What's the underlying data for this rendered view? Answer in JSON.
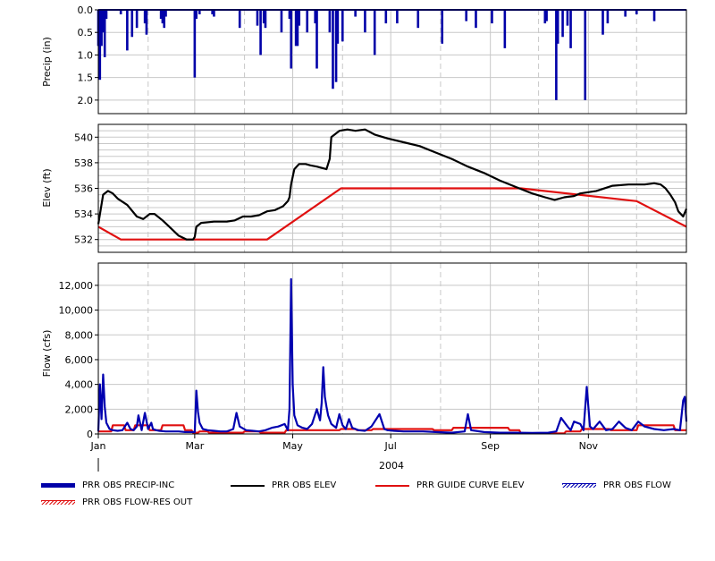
{
  "chart_data": [
    {
      "type": "bar",
      "ylabel": "Precip (in)",
      "ylim": [
        2.3,
        0
      ],
      "yticks": [
        "0.0",
        "0.5",
        "1.0",
        "1.5",
        "2.0"
      ],
      "ytick_values": [
        0,
        0.5,
        1.0,
        1.5,
        2.0
      ],
      "x_domain_days": 366,
      "series": [
        {
          "name": "PRR OBS PRECIP-INC",
          "color": "#0000a8",
          "x_day": [
            0,
            1,
            2,
            3,
            4,
            5,
            14,
            18,
            21,
            24,
            29,
            30,
            39,
            40,
            41,
            42,
            60,
            61,
            63,
            71,
            72,
            88,
            99,
            101,
            103,
            104,
            114,
            119,
            120,
            123,
            124,
            125,
            130,
            135,
            136,
            144,
            146,
            148,
            149,
            152,
            160,
            166,
            172,
            179,
            186,
            199,
            214,
            229,
            235,
            245,
            253,
            278,
            279,
            285,
            286,
            289,
            292,
            294,
            303,
            314,
            317,
            328,
            335,
            346
          ],
          "values": [
            0.8,
            1.55,
            0.8,
            0.5,
            1.05,
            0.2,
            0.1,
            0.9,
            0.6,
            0.4,
            0.3,
            0.55,
            0.2,
            0.3,
            0.4,
            0.15,
            1.5,
            0.2,
            0.1,
            0.1,
            0.15,
            0.4,
            0.35,
            1.0,
            0.3,
            0.4,
            0.5,
            0.2,
            1.3,
            0.8,
            0.8,
            0.35,
            0.5,
            0.3,
            1.3,
            0.5,
            1.75,
            1.6,
            0.75,
            0.7,
            0.15,
            0.5,
            1.0,
            0.3,
            0.3,
            0.4,
            0.75,
            0.25,
            0.4,
            0.3,
            0.85,
            0.3,
            0.25,
            2.0,
            0.75,
            0.6,
            0.35,
            0.85,
            2.0,
            0.55,
            0.3,
            0.15,
            0.1,
            0.25
          ]
        }
      ]
    },
    {
      "type": "line",
      "ylabel": "Elev (ft)",
      "ylim": [
        531,
        541
      ],
      "yticks": [
        "532",
        "534",
        "536",
        "538",
        "540"
      ],
      "ytick_values": [
        532,
        534,
        536,
        538,
        540
      ],
      "x_domain_days": 366,
      "series": [
        {
          "name": "PRR OBS ELEV",
          "color": "#000000",
          "x_day": [
            0,
            3,
            6,
            9,
            12,
            18,
            24,
            28,
            32,
            35,
            40,
            45,
            50,
            55,
            59,
            60,
            61,
            64,
            72,
            80,
            85,
            90,
            95,
            100,
            105,
            110,
            115,
            118,
            119,
            120,
            122,
            125,
            129,
            132,
            136,
            142,
            144,
            145,
            150,
            155,
            160,
            166,
            172,
            180,
            190,
            200,
            210,
            220,
            230,
            240,
            250,
            262,
            270,
            278,
            284,
            290,
            296,
            300,
            310,
            320,
            330,
            340,
            346,
            350,
            353,
            356,
            359,
            361,
            364,
            366
          ],
          "values": [
            533.2,
            535.5,
            535.8,
            535.6,
            535.2,
            534.7,
            533.8,
            533.6,
            534.0,
            534.0,
            533.5,
            532.9,
            532.3,
            532.0,
            532.0,
            532.2,
            533.0,
            533.3,
            533.4,
            533.4,
            533.5,
            533.8,
            533.8,
            533.9,
            534.2,
            534.3,
            534.6,
            535.0,
            535.3,
            536.3,
            537.5,
            537.9,
            537.9,
            537.8,
            537.7,
            537.5,
            538.3,
            540.0,
            540.5,
            540.6,
            540.5,
            540.6,
            540.2,
            539.9,
            539.6,
            539.3,
            538.8,
            538.3,
            537.7,
            537.2,
            536.6,
            536.0,
            535.6,
            535.3,
            535.1,
            535.3,
            535.4,
            535.6,
            535.8,
            536.2,
            536.3,
            536.3,
            536.4,
            536.3,
            536.0,
            535.5,
            534.9,
            534.2,
            533.8,
            534.4
          ]
        },
        {
          "name": "PRR GUIDE CURVE ELEV",
          "color": "#e01010",
          "x_day": [
            0,
            14,
            105,
            151,
            263,
            335,
            366
          ],
          "values": [
            533.0,
            532.0,
            532.0,
            536.0,
            536.0,
            535.0,
            533.0
          ]
        }
      ]
    },
    {
      "type": "line",
      "ylabel": "Flow (cfs)",
      "ylim": [
        0,
        13800
      ],
      "yticks": [
        "0",
        "2,000",
        "4,000",
        "6,000",
        "8,000",
        "10,000",
        "12,000"
      ],
      "ytick_values": [
        0,
        2000,
        4000,
        6000,
        8000,
        10000,
        12000
      ],
      "x_domain_days": 366,
      "x_tick_labels": [
        "Jan",
        "Mar",
        "May",
        "Jul",
        "Sep",
        "Nov"
      ],
      "x_tick_days": [
        0,
        60,
        121,
        182,
        244,
        305
      ],
      "x_minor_days": [
        31,
        91,
        152,
        213,
        274,
        335
      ],
      "year_label": "2004",
      "series": [
        {
          "name": "PRR OBS FLOW",
          "color": "#0000b0",
          "x_day": [
            0,
            1,
            2,
            3,
            4,
            5,
            7,
            9,
            12,
            15,
            18,
            20,
            22,
            24,
            25,
            27,
            29,
            31,
            33,
            34,
            36,
            38,
            42,
            46,
            50,
            54,
            58,
            60,
            61,
            62,
            63,
            65,
            68,
            72,
            76,
            80,
            84,
            86,
            88,
            92,
            96,
            100,
            104,
            108,
            112,
            116,
            118,
            119,
            120,
            121,
            122,
            124,
            127,
            130,
            133,
            136,
            138,
            139,
            140,
            141,
            142,
            143,
            145,
            148,
            150,
            152,
            154,
            156,
            158,
            162,
            166,
            170,
            175,
            178,
            180,
            184,
            190,
            196,
            202,
            210,
            220,
            228,
            230,
            232,
            240,
            250,
            260,
            270,
            280,
            285,
            288,
            292,
            294,
            296,
            300,
            302,
            304,
            306,
            308,
            312,
            316,
            320,
            324,
            328,
            332,
            336,
            340,
            346,
            352,
            358,
            362,
            364,
            365,
            366
          ],
          "values": [
            200,
            4000,
            1200,
            4800,
            2200,
            900,
            400,
            300,
            250,
            300,
            900,
            400,
            300,
            600,
            1500,
            300,
            1700,
            400,
            900,
            400,
            300,
            250,
            200,
            200,
            200,
            150,
            150,
            150,
            3500,
            1800,
            900,
            400,
            300,
            250,
            200,
            200,
            400,
            1700,
            600,
            300,
            250,
            200,
            300,
            500,
            600,
            800,
            300,
            2000,
            12500,
            4000,
            1500,
            700,
            500,
            400,
            800,
            2000,
            1100,
            2500,
            5400,
            3000,
            2200,
            1500,
            800,
            500,
            1600,
            700,
            400,
            1200,
            500,
            300,
            250,
            600,
            1600,
            400,
            300,
            250,
            200,
            200,
            200,
            150,
            100,
            200,
            1600,
            300,
            150,
            100,
            100,
            80,
            100,
            200,
            1300,
            600,
            300,
            1000,
            800,
            300,
            3800,
            600,
            400,
            1000,
            300,
            400,
            1000,
            500,
            300,
            1000,
            600,
            400,
            300,
            400,
            300,
            2700,
            3000,
            1000
          ]
        },
        {
          "name": "PRR OBS FLOW-RES OUT",
          "color": "#e01010",
          "x_day": [
            0,
            8,
            9,
            16,
            17,
            22,
            23,
            31,
            32,
            39,
            40,
            53,
            54,
            58,
            59,
            62,
            63,
            68,
            69,
            90,
            91,
            100,
            101,
            116,
            117,
            150,
            151,
            160,
            161,
            170,
            171,
            208,
            209,
            220,
            221,
            255,
            256,
            262,
            263,
            290,
            291,
            300,
            301,
            318,
            319,
            335,
            336,
            358,
            359,
            366
          ],
          "values": [
            200,
            200,
            700,
            700,
            300,
            300,
            700,
            700,
            300,
            300,
            700,
            700,
            300,
            300,
            100,
            100,
            200,
            200,
            100,
            100,
            200,
            200,
            100,
            100,
            300,
            300,
            400,
            400,
            300,
            300,
            400,
            400,
            300,
            300,
            500,
            500,
            300,
            300,
            50,
            50,
            200,
            200,
            400,
            400,
            300,
            300,
            700,
            700,
            300,
            300
          ]
        }
      ]
    }
  ],
  "legend": [
    {
      "label": "PRR OBS PRECIP-INC",
      "color": "#0000a8",
      "style": "thick"
    },
    {
      "label": "PRR OBS ELEV",
      "color": "#000000",
      "style": "line"
    },
    {
      "label": "PRR GUIDE CURVE ELEV",
      "color": "#e01010",
      "style": "line"
    },
    {
      "label": "PRR OBS FLOW",
      "color": "#0000b0",
      "style": "hatched"
    },
    {
      "label": "PRR OBS FLOW-RES OUT",
      "color": "#e01010",
      "style": "hatched"
    }
  ]
}
